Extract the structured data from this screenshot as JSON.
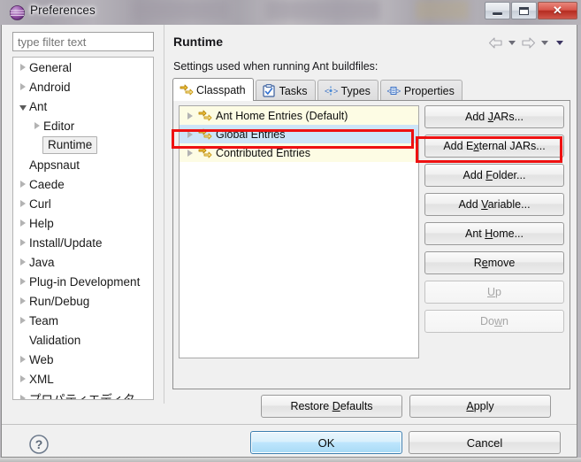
{
  "window": {
    "title": "Preferences",
    "icon": "eclipse-sphere-icon",
    "buttons": {
      "minimize": "minimize-icon",
      "maximize": "restore-icon",
      "close": "✕"
    }
  },
  "filter": {
    "placeholder": "type filter text",
    "value": ""
  },
  "tree": {
    "items": [
      {
        "label": "General",
        "indent": 0,
        "state": "collapsed"
      },
      {
        "label": "Android",
        "indent": 0,
        "state": "collapsed"
      },
      {
        "label": "Ant",
        "indent": 0,
        "state": "expanded"
      },
      {
        "label": "Editor",
        "indent": 1,
        "state": "collapsed"
      },
      {
        "label": "Runtime",
        "indent": 1,
        "state": "leaf",
        "selected": true
      },
      {
        "label": "Appsnaut",
        "indent": 0,
        "state": "leaf"
      },
      {
        "label": "Caede",
        "indent": 0,
        "state": "collapsed"
      },
      {
        "label": "Curl",
        "indent": 0,
        "state": "collapsed"
      },
      {
        "label": "Help",
        "indent": 0,
        "state": "collapsed"
      },
      {
        "label": "Install/Update",
        "indent": 0,
        "state": "collapsed"
      },
      {
        "label": "Java",
        "indent": 0,
        "state": "collapsed"
      },
      {
        "label": "Plug-in Development",
        "indent": 0,
        "state": "collapsed"
      },
      {
        "label": "Run/Debug",
        "indent": 0,
        "state": "collapsed"
      },
      {
        "label": "Team",
        "indent": 0,
        "state": "collapsed"
      },
      {
        "label": "Validation",
        "indent": 0,
        "state": "leaf"
      },
      {
        "label": "Web",
        "indent": 0,
        "state": "collapsed"
      },
      {
        "label": "XML",
        "indent": 0,
        "state": "collapsed"
      },
      {
        "label": "プロパティエディタ",
        "indent": 0,
        "state": "collapsed"
      }
    ]
  },
  "page": {
    "title": "Runtime",
    "description": "Settings used when running Ant buildfiles:",
    "nav": {
      "back": "back-arrow-icon",
      "back_menu": "chevron-down-icon",
      "forward": "forward-arrow-icon",
      "forward_menu": "chevron-down-icon",
      "page_menu": "chevron-down-icon"
    }
  },
  "tabs": [
    {
      "label": "Classpath",
      "icon": "ant-classpath-icon",
      "active": true
    },
    {
      "label": "Tasks",
      "icon": "ant-tasks-icon",
      "active": false
    },
    {
      "label": "Types",
      "icon": "ant-types-icon",
      "active": false
    },
    {
      "label": "Properties",
      "icon": "ant-properties-icon",
      "active": false
    }
  ],
  "classpath_entries": [
    {
      "label": "Ant Home Entries (Default)",
      "selected": false
    },
    {
      "label": "Global Entries",
      "selected": true
    },
    {
      "label": "Contributed Entries",
      "selected": false
    }
  ],
  "side_buttons": [
    {
      "label": "Add JARs...",
      "mnemonic": "J",
      "enabled": true,
      "highlighted": false
    },
    {
      "label": "Add External JARs...",
      "mnemonic": "x",
      "enabled": true,
      "highlighted": true
    },
    {
      "label": "Add Folder...",
      "mnemonic": "F",
      "enabled": true,
      "highlighted": false
    },
    {
      "label": "Add Variable...",
      "mnemonic": "V",
      "enabled": true,
      "highlighted": false
    },
    {
      "label": "Ant Home...",
      "mnemonic": "H",
      "enabled": true,
      "highlighted": false
    },
    {
      "label": "Remove",
      "mnemonic": "e",
      "enabled": true,
      "highlighted": false
    },
    {
      "label": "Up",
      "mnemonic": "U",
      "enabled": false,
      "highlighted": false
    },
    {
      "label": "Down",
      "mnemonic": "w",
      "enabled": false,
      "highlighted": false
    }
  ],
  "page_buttons": [
    {
      "label": "Restore Defaults",
      "mnemonic": "D"
    },
    {
      "label": "Apply",
      "mnemonic": "A"
    }
  ],
  "footer": {
    "help": "?",
    "ok": "OK",
    "cancel": "Cancel"
  },
  "colors": {
    "selection_blue": "#cde4f7",
    "list_yellow": "#fdfce4",
    "annotation_red": "#ee1111",
    "ok_focus_blue": "#bee6fd",
    "close_red": "#c0392b"
  }
}
